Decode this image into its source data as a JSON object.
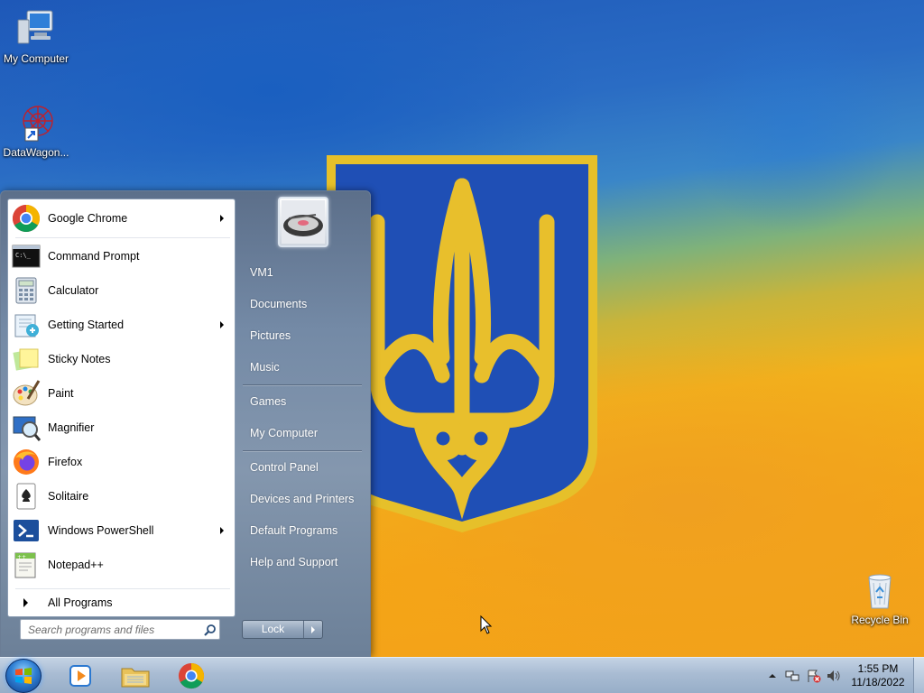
{
  "desktop": {
    "icons": [
      {
        "label": "My Computer",
        "icon": "computer-icon"
      },
      {
        "label": "DataWagon...",
        "icon": "datawagon-shortcut-icon"
      },
      {
        "label": "Recycle Bin",
        "icon": "recycle-bin-icon"
      }
    ],
    "wallpaper": {
      "blue": "#2a6cc4",
      "yellow": "#f5a516",
      "emblem_gold": "#e8bf2c",
      "emblem_blue": "#1f4fb5"
    }
  },
  "start_menu": {
    "programs": [
      {
        "label": "Google Chrome",
        "icon": "chrome-icon",
        "submenu": true
      },
      {
        "label": "Command Prompt",
        "icon": "command-prompt-icon",
        "submenu": false
      },
      {
        "label": "Calculator",
        "icon": "calculator-icon",
        "submenu": false
      },
      {
        "label": "Getting Started",
        "icon": "getting-started-icon",
        "submenu": true
      },
      {
        "label": "Sticky Notes",
        "icon": "sticky-notes-icon",
        "submenu": false
      },
      {
        "label": "Paint",
        "icon": "paint-icon",
        "submenu": false
      },
      {
        "label": "Magnifier",
        "icon": "magnifier-icon",
        "submenu": false
      },
      {
        "label": "Firefox",
        "icon": "firefox-icon",
        "submenu": false
      },
      {
        "label": "Solitaire",
        "icon": "solitaire-icon",
        "submenu": false
      },
      {
        "label": "Windows PowerShell",
        "icon": "powershell-icon",
        "submenu": true
      },
      {
        "label": "Notepad++",
        "icon": "notepad-plus-plus-icon",
        "submenu": false
      }
    ],
    "all_programs": "All Programs",
    "search_placeholder": "Search programs and files",
    "right_items": [
      {
        "label": "VM1"
      },
      {
        "label": "Documents"
      },
      {
        "label": "Pictures"
      },
      {
        "label": "Music"
      },
      {
        "label": "Games"
      },
      {
        "label": "My Computer"
      },
      {
        "label": "Control Panel"
      },
      {
        "label": "Devices and Printers"
      },
      {
        "label": "Default Programs"
      },
      {
        "label": "Help and Support"
      }
    ],
    "lock_label": "Lock"
  },
  "taskbar": {
    "pinned": [
      {
        "icon": "windows-media-player-icon"
      },
      {
        "icon": "windows-explorer-icon"
      },
      {
        "icon": "chrome-icon"
      }
    ],
    "clock": {
      "time": "1:55 PM",
      "date": "11/18/2022"
    }
  }
}
